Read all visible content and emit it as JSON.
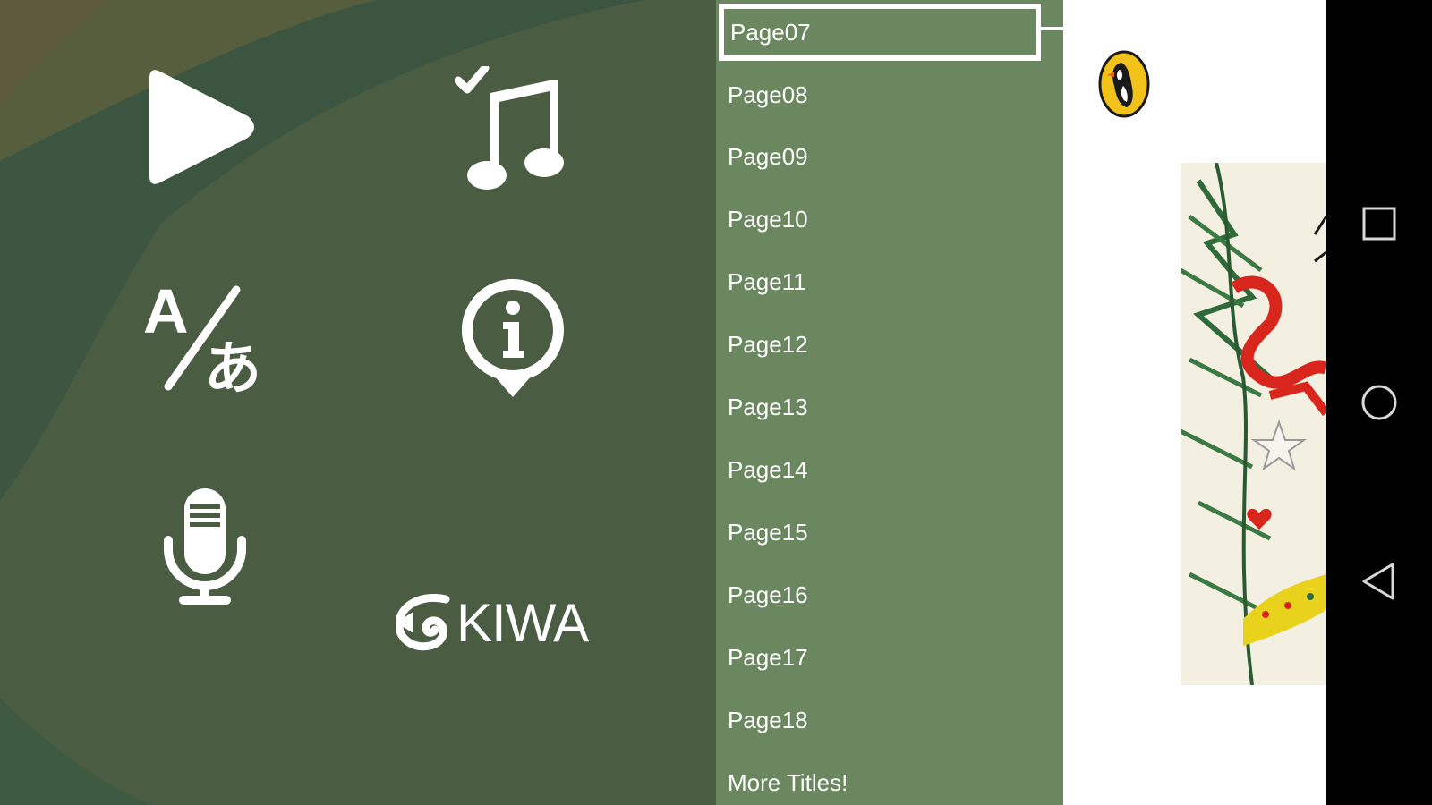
{
  "menu": {
    "play_icon": "play-icon",
    "music_icon": "music-note-check-icon",
    "language_icon": "language-translate-icon",
    "info_icon": "info-icon",
    "mic_icon": "microphone-icon",
    "brand_logo_text": "KIWA"
  },
  "page_list": {
    "items": [
      {
        "label": "Page07",
        "selected": true
      },
      {
        "label": "Page08"
      },
      {
        "label": "Page09"
      },
      {
        "label": "Page10"
      },
      {
        "label": "Page11"
      },
      {
        "label": "Page12"
      },
      {
        "label": "Page13"
      },
      {
        "label": "Page14"
      },
      {
        "label": "Page15"
      },
      {
        "label": "Page16"
      },
      {
        "label": "Page17"
      },
      {
        "label": "Page18"
      },
      {
        "label": "More Titles!"
      }
    ]
  },
  "book": {
    "publisher_logo": "puffin-logo",
    "cover_art": "christmas-tree-branch-illustration"
  },
  "nav_bar": {
    "recents_icon": "square-icon",
    "home_icon": "circle-icon",
    "back_icon": "triangle-back-icon"
  },
  "colors": {
    "menu_background": "#4a5d42",
    "list_background": "#6a875f",
    "nav_background": "#000000"
  }
}
